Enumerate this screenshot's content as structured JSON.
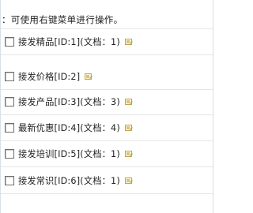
{
  "hint": {
    "text": "：可使用右键菜单进行操作。"
  },
  "categories": [
    {
      "label": "接发精品[ID:1](文档：1)"
    },
    {
      "label": "接发价格[ID:2]"
    },
    {
      "label": "接发产品[ID:3](文档：3)"
    },
    {
      "label": "最新优惠[ID:4](文档：4)"
    },
    {
      "label": "接发培训[ID:5](文档：1)"
    },
    {
      "label": "接发常识[ID:6](文档：1)"
    }
  ],
  "icons": {
    "row_icon": "edit-note-icon",
    "row_icon_color": "#d9b25a"
  },
  "colors": {
    "row_divider": "#e6e6e6",
    "panel_border": "#d7dfe8"
  }
}
